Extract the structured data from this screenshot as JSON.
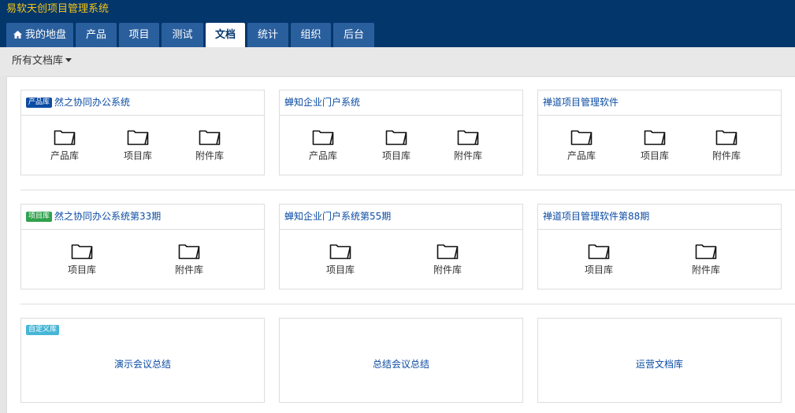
{
  "app": {
    "title": "易软天创项目管理系统"
  },
  "nav": {
    "tabs": [
      {
        "label": "我的地盘",
        "icon": "home-icon",
        "active": false
      },
      {
        "label": "产品",
        "active": false
      },
      {
        "label": "项目",
        "active": false
      },
      {
        "label": "测试",
        "active": false
      },
      {
        "label": "文档",
        "active": true
      },
      {
        "label": "统计",
        "active": false
      },
      {
        "label": "组织",
        "active": false
      },
      {
        "label": "后台",
        "active": false
      }
    ]
  },
  "subnav": {
    "all_libs_label": "所有文档库"
  },
  "product_libs": {
    "badge": "产品库",
    "cards": [
      {
        "title": "然之协同办公系统",
        "libs": [
          "产品库",
          "项目库",
          "附件库"
        ]
      },
      {
        "title": "蝉知企业门户系统",
        "libs": [
          "产品库",
          "项目库",
          "附件库"
        ]
      },
      {
        "title": "禅道项目管理软件",
        "libs": [
          "产品库",
          "项目库",
          "附件库"
        ]
      }
    ]
  },
  "project_libs": {
    "badge": "项目库",
    "cards": [
      {
        "title": "然之协同办公系统第33期",
        "libs": [
          "项目库",
          "附件库"
        ]
      },
      {
        "title": "蝉知企业门户系统第55期",
        "libs": [
          "项目库",
          "附件库"
        ]
      },
      {
        "title": "禅道项目管理软件第88期",
        "libs": [
          "项目库",
          "附件库"
        ]
      }
    ]
  },
  "custom_libs": {
    "badge": "自定义库",
    "items": [
      "演示会议总结",
      "总结会议总结",
      "运营文档库"
    ]
  },
  "colors": {
    "header_bg": "#03366b",
    "title_text": "#f5c518",
    "tab_bg": "#2a5f9e",
    "link": "#0c4ca3",
    "badge_product": "#0c4ca3",
    "badge_project": "#2fa24d",
    "badge_custom": "#46b6d6"
  }
}
